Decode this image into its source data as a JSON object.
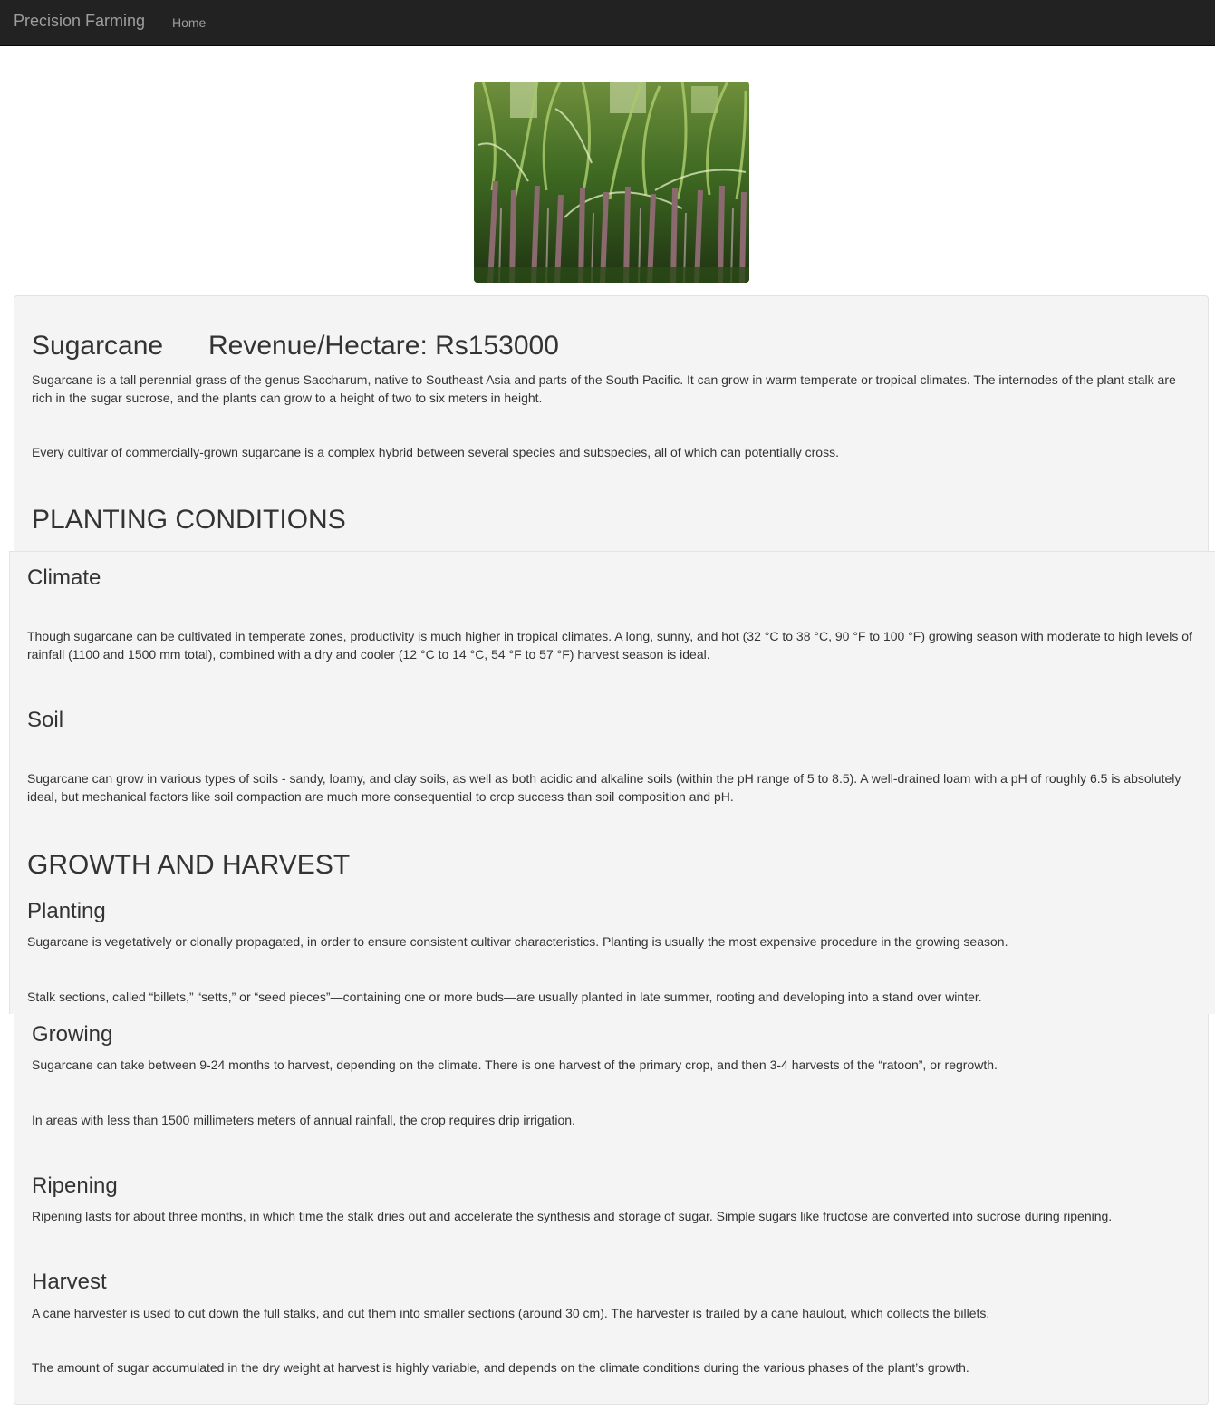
{
  "navbar": {
    "brand": "Precision Farming",
    "links": [
      "Home"
    ]
  },
  "hero_image": {
    "alt": "Sugarcane field"
  },
  "crop": {
    "name": "Sugarcane",
    "revenue": "Revenue/Hectare: Rs153000",
    "intro": [
      "Sugarcane is a tall perennial grass of the genus Saccharum, native to Southeast Asia and parts of the South Pacific. It can grow in warm temperate or tropical climates. The internodes of the plant stalk are rich in the sugar sucrose, and the plants can grow to a height of two to six meters in height.",
      "Every cultivar of commercially-grown sugarcane is a complex hybrid between several species and subspecies, all of which can potentially cross."
    ]
  },
  "planting_conditions": {
    "title": "PLANTING CONDITIONS",
    "climate": {
      "title": "Climate",
      "text": "Though sugarcane can be cultivated in temperate zones, productivity is much higher in tropical climates. A long, sunny, and hot (32 °C to 38 °C, 90 °F to 100 °F) growing season with moderate to high levels of rainfall (1100 and 1500 mm total), combined with a dry and cooler (12 °C to 14 °C, 54 °F to 57 °F) harvest season is ideal."
    },
    "soil": {
      "title": "Soil",
      "text": "Sugarcane can grow in various types of soils - sandy, loamy, and clay soils, as well as both acidic and alkaline soils (within the pH range of 5 to 8.5). A well-drained loam with a pH of roughly 6.5 is absolutely ideal, but mechanical factors like soil compaction are much more consequential to crop success than soil composition and pH."
    }
  },
  "growth_and_harvest": {
    "title": "GROWTH AND HARVEST",
    "planting": {
      "title": "Planting",
      "paragraphs": [
        "Sugarcane is vegetatively or clonally propagated, in order to ensure consistent cultivar characteristics. Planting is usually the most expensive procedure in the growing season.",
        "Stalk sections, called “billets,” “setts,” or “seed pieces”—containing one or more buds—are usually planted in late summer, rooting and developing into a stand over winter."
      ]
    },
    "growing": {
      "title": "Growing",
      "paragraphs": [
        "Sugarcane can take between 9-24 months to harvest, depending on the climate. There is one harvest of the primary crop, and then 3-4 harvests of the “ratoon”, or regrowth.",
        "In areas with less than 1500 millimeters meters of annual rainfall, the crop requires drip irrigation."
      ]
    },
    "ripening": {
      "title": "Ripening",
      "text": "Ripening lasts for about three months, in which time the stalk dries out and accelerate the synthesis and storage of sugar. Simple sugars like fructose are converted into sucrose during ripening."
    },
    "harvest": {
      "title": "Harvest",
      "paragraphs": [
        "A cane harvester is used to cut down the full stalks, and cut them into smaller sections (around 30 cm). The harvester is trailed by a cane haulout, which collects the billets.",
        "The amount of sugar accumulated in the dry weight at harvest is highly variable, and depends on the climate conditions during the various phases of the plant’s growth."
      ]
    }
  },
  "colors": {
    "navbar_bg": "#222222",
    "navbar_text": "#9d9d9d",
    "well_bg": "#f4f4f4",
    "text": "#333333"
  }
}
